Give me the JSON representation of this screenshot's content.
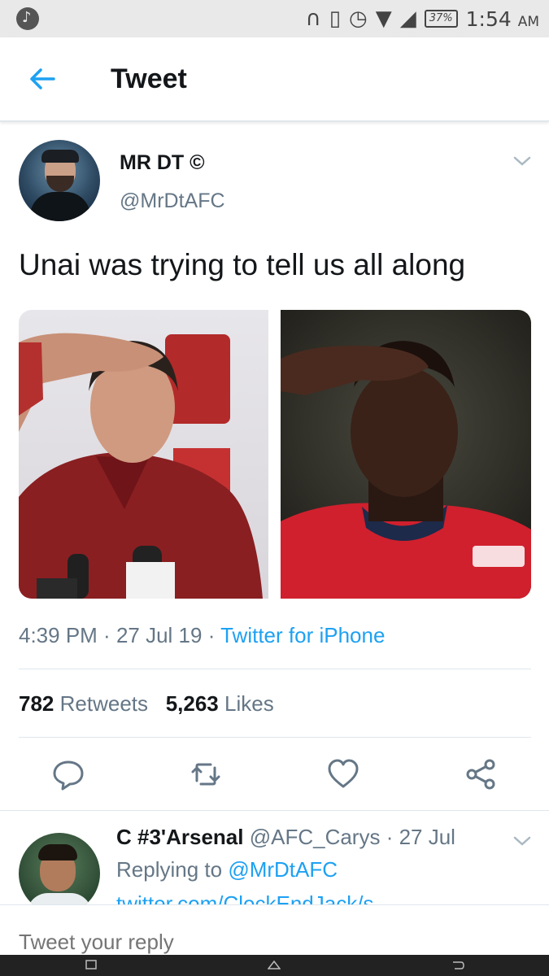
{
  "status_bar": {
    "battery": "37%",
    "time": "1:54",
    "ampm": "AM"
  },
  "app_bar": {
    "title": "Tweet"
  },
  "tweet": {
    "author_name": "MR DT ©",
    "author_handle": "@MrDtAFC",
    "text": "Unai was trying to tell us all along",
    "time": "4:39 PM",
    "date": "27 Jul 19",
    "source": "Twitter for iPhone",
    "retweets_count": "782",
    "retweets_label": "Retweets",
    "likes_count": "5,263",
    "likes_label": "Likes"
  },
  "reply": {
    "author_name": "C #3'Arsenal",
    "author_handle": "@AFC_Carys",
    "date": "27 Jul",
    "replying_prefix": "Replying to",
    "replying_to": "@MrDtAFC",
    "link": "twitter.com/ClockEndJack/s..."
  },
  "composer": {
    "placeholder": "Tweet your reply"
  },
  "colors": {
    "accent": "#1da1f2",
    "secondary_text": "#657786",
    "primary_text": "#14171a"
  },
  "icons": [
    "music-note-icon",
    "headphones-icon",
    "phone-icon",
    "alarm-icon",
    "wifi-icon",
    "signal-icon",
    "battery-icon",
    "back-arrow-icon",
    "chevron-down-icon",
    "reply-icon",
    "retweet-icon",
    "like-icon",
    "share-icon",
    "recents-icon",
    "home-icon",
    "back-nav-icon"
  ]
}
